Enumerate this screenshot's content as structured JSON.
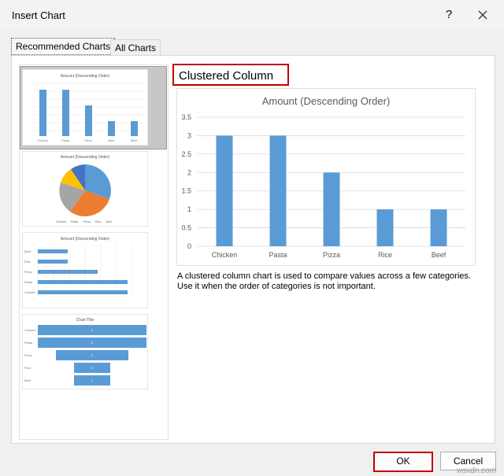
{
  "window": {
    "title": "Insert Chart",
    "help": "?"
  },
  "tabs": [
    {
      "label": "Recommended Charts"
    },
    {
      "label": "All Charts"
    }
  ],
  "selected": {
    "name": "Clustered Column",
    "description_lines": [
      "A clustered column chart is used to compare values across a few categories.",
      "Use it when the order of categories is not important."
    ]
  },
  "chart_data": {
    "type": "bar",
    "title": "Amount (Descending Order)",
    "categories": [
      "Chicken",
      "Pasta",
      "Pizza",
      "Rice",
      "Beef"
    ],
    "values": [
      3,
      3,
      2,
      1,
      1
    ],
    "ylim": [
      0,
      3.5
    ],
    "yticks": [
      "0",
      "0.5",
      "1",
      "1.5",
      "2",
      "2.5",
      "3",
      "3.5"
    ],
    "color": "#5b9bd5",
    "grid": true
  },
  "thumbnails": [
    {
      "type": "column",
      "title": "Amount (Descending Order)"
    },
    {
      "type": "pie",
      "title": "Amount (Descending Order)",
      "legend": [
        "Chicken",
        "Pasta",
        "Pizza",
        "Rice",
        "Beef"
      ]
    },
    {
      "type": "bar",
      "title": "Amount (Descending Order)"
    },
    {
      "type": "funnel",
      "title": "Chart Title"
    }
  ],
  "buttons": {
    "ok": "OK",
    "cancel": "Cancel"
  },
  "watermark": "wsxdn.com"
}
